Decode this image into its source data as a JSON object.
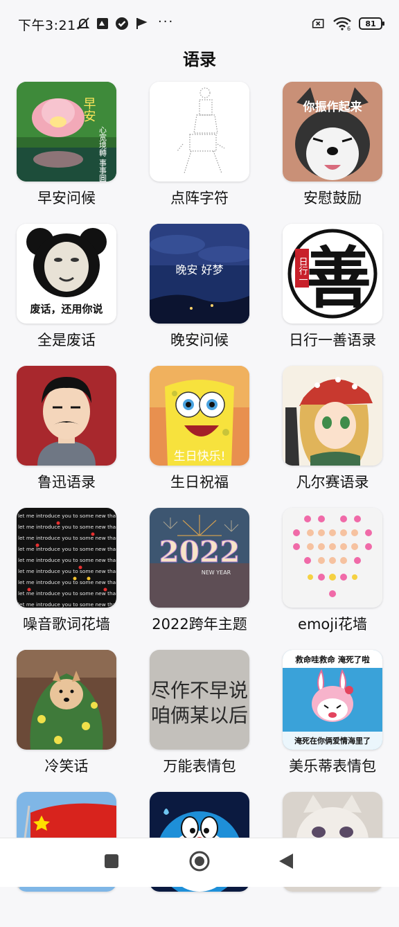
{
  "status_bar": {
    "time": "下午3:21",
    "more": "···",
    "battery": "81",
    "wifi_label": "6",
    "icons": [
      "mute-icon",
      "app-notification-icon",
      "check-badge-icon",
      "flag-icon",
      "no-sim-icon",
      "wifi-icon",
      "battery-icon"
    ]
  },
  "page": {
    "title": "语录"
  },
  "thumb_text": {
    "morning_big": "早安",
    "morning_small": "心宽境轉 事事圓滿",
    "husky": "你振作起来",
    "panda": "废话，还用你说",
    "night": "晚安  好梦",
    "shan": "善",
    "shan_side": "日行一",
    "birthday": "生日快乐!",
    "year": "2022",
    "year_sub": "NEW YEAR",
    "noise_line": "let me introduce you to some new thangs !",
    "melody_top": "救命哇救命 淹死了啦",
    "melody_bottom": "淹死在你俩爱情海里了",
    "wall1": "尽作不早说",
    "wall2": "咱俩某以后"
  },
  "items": [
    {
      "label": "早安问候"
    },
    {
      "label": "点阵字符"
    },
    {
      "label": "安慰鼓励"
    },
    {
      "label": "全是废话"
    },
    {
      "label": "晚安问候"
    },
    {
      "label": "日行一善语录"
    },
    {
      "label": "鲁迅语录"
    },
    {
      "label": "生日祝福"
    },
    {
      "label": "凡尔赛语录"
    },
    {
      "label": "噪音歌词花墙"
    },
    {
      "label": "2022跨年主题"
    },
    {
      "label": "emoji花墙"
    },
    {
      "label": "冷笑话"
    },
    {
      "label": "万能表情包"
    },
    {
      "label": "美乐蒂表情包"
    },
    {
      "label": ""
    },
    {
      "label": ""
    },
    {
      "label": ""
    }
  ],
  "nav": {
    "icons": [
      "recents-square-icon",
      "home-circle-icon",
      "back-triangle-icon"
    ]
  }
}
